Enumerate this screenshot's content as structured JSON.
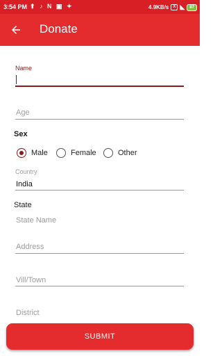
{
  "status_bar": {
    "time": "3:54 PM",
    "icons_left": "⬆ ♪ N ▣ ✦",
    "network_speed": "4.9KB/s",
    "sim_badge": "X",
    "wifi": "◣",
    "battery": "87"
  },
  "app_bar": {
    "title": "Donate",
    "back_icon": "arrow-left"
  },
  "form": {
    "name": {
      "label": "Name",
      "value": ""
    },
    "age": {
      "placeholder": "Age"
    },
    "sex": {
      "label": "Sex",
      "options": [
        "Male",
        "Female",
        "Other"
      ],
      "selected": "Male"
    },
    "country": {
      "label": "Country",
      "value": "India"
    },
    "state": {
      "label": "State",
      "placeholder": "State Name"
    },
    "address": {
      "placeholder": "Address"
    },
    "vill_town": {
      "placeholder": "Vill/Town"
    },
    "district": {
      "placeholder": "District"
    }
  },
  "submit_label": "SUBMIT",
  "colors": {
    "primary": "#e42b2e",
    "status_bar": "#d81f26",
    "accent": "#8b1a1a"
  }
}
